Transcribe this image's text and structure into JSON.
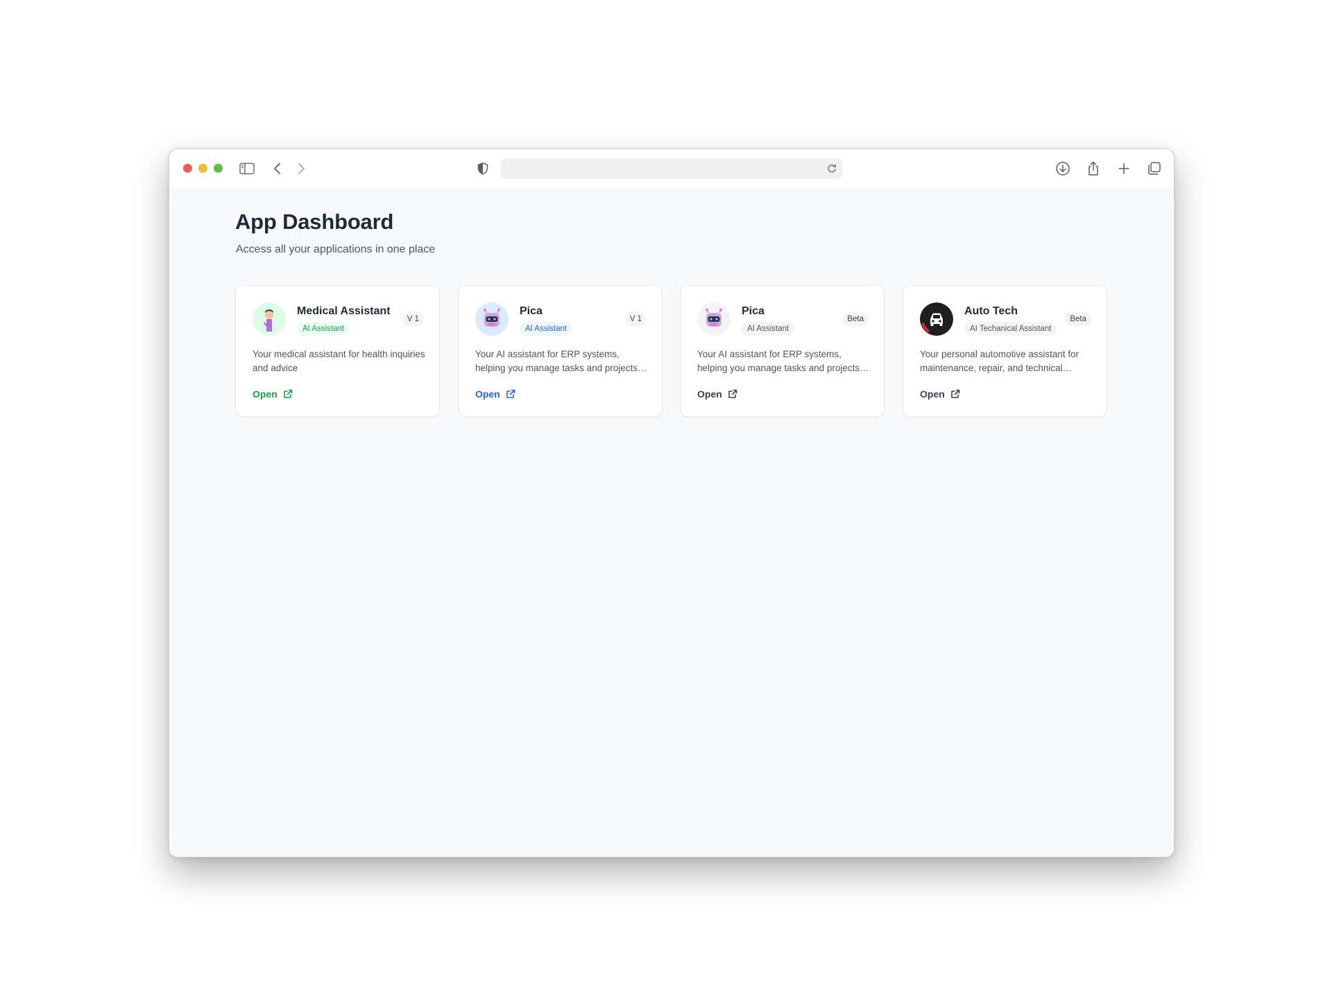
{
  "browser": {
    "url": "",
    "icons": [
      "sidebar-icon",
      "back-icon",
      "forward-icon",
      "shield-icon",
      "reload-icon",
      "download-icon",
      "share-icon",
      "new-tab-icon",
      "tabs-icon"
    ]
  },
  "page": {
    "title": "App Dashboard",
    "subtitle": "Access all your applications in one place"
  },
  "apps": [
    {
      "name": "Medical Assistant",
      "tag": "AI Assistant",
      "badge": "V 1",
      "description": "Your medical assistant for health inquiries and advice",
      "open_label": "Open",
      "accent": "#16a34a",
      "tag_bg": "#ecfdf3",
      "avatar_bg": "#dcfce7",
      "icon": "doctor-icon"
    },
    {
      "name": "Pica",
      "tag": "AI Assistant",
      "badge": "V 1",
      "description": "Your AI assistant for ERP systems, helping you manage tasks and projects efficiently",
      "open_label": "Open",
      "accent": "#2563eb",
      "tag_bg": "#eff6ff",
      "avatar_bg": "#dbeafe",
      "icon": "robot-icon"
    },
    {
      "name": "Pica",
      "tag": "AI Assistant",
      "badge": "Beta",
      "description": "Your AI assistant for ERP systems, helping you manage tasks and projects efficiently",
      "open_label": "Open",
      "accent": "#374151",
      "tag_bg": "#f3f4f6",
      "avatar_bg": "#f3f4f6",
      "icon": "robot-icon"
    },
    {
      "name": "Auto Tech",
      "tag": "AI Techanical Assistant",
      "badge": "Beta",
      "description": "Your personal automotive assistant for maintenance, repair, and technical support",
      "open_label": "Open",
      "accent": "#374151",
      "tag_bg": "#f3f4f6",
      "avatar_bg": "#1f1f1f",
      "icon": "car-icon"
    }
  ]
}
